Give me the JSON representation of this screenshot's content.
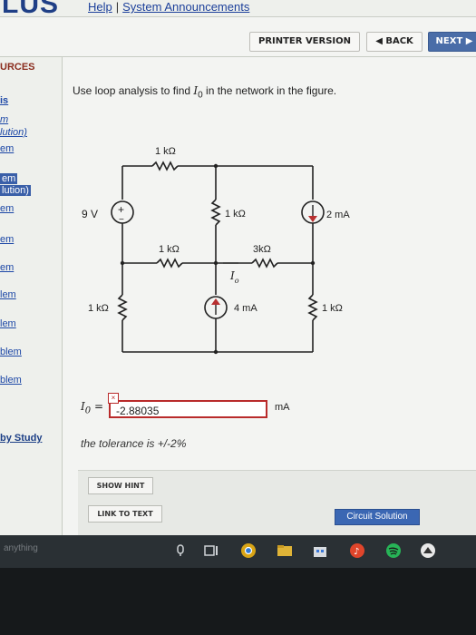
{
  "header": {
    "logo_text": "LUS",
    "links": [
      "Help",
      "System Announcements"
    ],
    "link_separator": "|"
  },
  "nav": {
    "printer_version": "PRINTER VERSION",
    "back": "◀ BACK",
    "next": "NEXT ▶"
  },
  "sidebar": {
    "title": "URCES",
    "items": [
      {
        "label": "is",
        "style": "bold"
      },
      {
        "label": "m",
        "style": "italic"
      },
      {
        "label": "lution)",
        "style": "italic"
      },
      {
        "label": "em",
        "style": ""
      },
      {
        "label": "em",
        "style": "selected"
      },
      {
        "label": "lution)",
        "style": "selected"
      },
      {
        "label": "em",
        "style": ""
      },
      {
        "label": "em",
        "style": ""
      },
      {
        "label": "em",
        "style": ""
      },
      {
        "label": "lem",
        "style": ""
      },
      {
        "label": "lem",
        "style": ""
      },
      {
        "label": "blem",
        "style": ""
      },
      {
        "label": "blem",
        "style": ""
      }
    ],
    "study": "by Study"
  },
  "question": {
    "text_before": "Use loop analysis to find ",
    "variable": "I",
    "subscript": "0",
    "text_after": " in the network in the figure."
  },
  "circuit": {
    "labels": {
      "r_top": "1 kΩ",
      "r_mid_vertical": "1 kΩ",
      "r_mid_left": "1 kΩ",
      "r_mid_right": "3kΩ",
      "r_left": "1 kΩ",
      "r_right": "1 kΩ",
      "voltage": "9 V",
      "current_top": "2 mA",
      "current_bottom": "4 mA",
      "io_label": "I",
      "io_sub": "o",
      "plus": "+",
      "minus": "−"
    }
  },
  "answer": {
    "label": "I",
    "label_sub": "0",
    "equals": "=",
    "value": "-2.88035",
    "unit": "mA",
    "error_mark": "×"
  },
  "tolerance": "the tolerance is +/-2%",
  "buttons": {
    "show_hint": "SHOW HINT",
    "link_to_text": "LINK TO TEXT",
    "circuit_solution": "Circuit Solution"
  },
  "taskbar": {
    "search_text": "anything"
  },
  "colors": {
    "accent_blue": "#3b67b3",
    "error_red": "#b92b2b",
    "link_blue": "#1c47a6"
  }
}
